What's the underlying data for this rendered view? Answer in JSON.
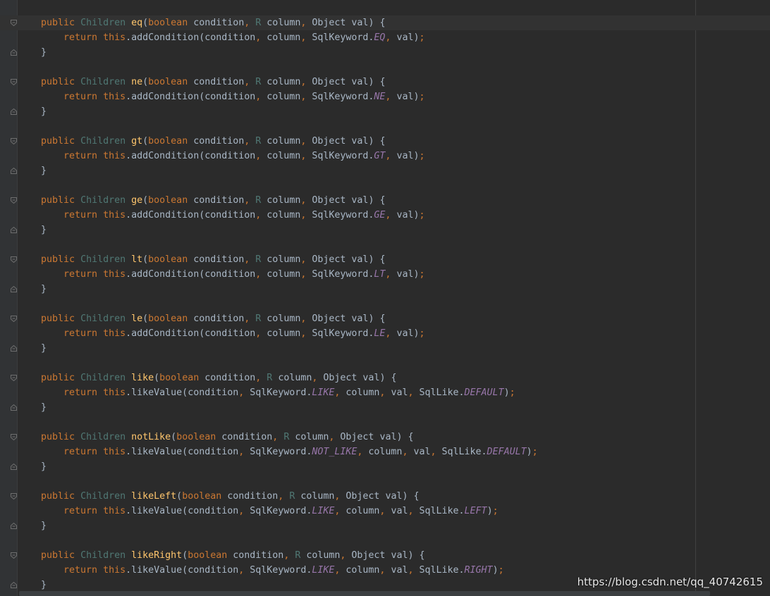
{
  "editor": {
    "language": "java",
    "colors": {
      "background": "#2b2b2b",
      "gutter": "#313335",
      "keyword": "#cc7832",
      "type_param": "#507874",
      "class_type": "#5f8fa0",
      "method": "#ffc66d",
      "constant": "#9876aa",
      "plain": "#a9b7c6",
      "current_line": "#323232"
    },
    "methods": [
      {
        "name": "eq",
        "params": [
          [
            "boolean",
            "condition"
          ],
          [
            "R",
            "column"
          ],
          [
            "Object",
            "val"
          ]
        ],
        "call": "addCondition",
        "args": [
          [
            "p",
            "condition"
          ],
          [
            "p",
            "column"
          ],
          [
            "k",
            "SqlKeyword."
          ],
          [
            "c",
            "EQ"
          ],
          [
            "p",
            "val"
          ]
        ]
      },
      {
        "name": "ne",
        "params": [
          [
            "boolean",
            "condition"
          ],
          [
            "R",
            "column"
          ],
          [
            "Object",
            "val"
          ]
        ],
        "call": "addCondition",
        "args": [
          [
            "p",
            "condition"
          ],
          [
            "p",
            "column"
          ],
          [
            "k",
            "SqlKeyword."
          ],
          [
            "c",
            "NE"
          ],
          [
            "p",
            "val"
          ]
        ]
      },
      {
        "name": "gt",
        "params": [
          [
            "boolean",
            "condition"
          ],
          [
            "R",
            "column"
          ],
          [
            "Object",
            "val"
          ]
        ],
        "call": "addCondition",
        "args": [
          [
            "p",
            "condition"
          ],
          [
            "p",
            "column"
          ],
          [
            "k",
            "SqlKeyword."
          ],
          [
            "c",
            "GT"
          ],
          [
            "p",
            "val"
          ]
        ]
      },
      {
        "name": "ge",
        "params": [
          [
            "boolean",
            "condition"
          ],
          [
            "R",
            "column"
          ],
          [
            "Object",
            "val"
          ]
        ],
        "call": "addCondition",
        "args": [
          [
            "p",
            "condition"
          ],
          [
            "p",
            "column"
          ],
          [
            "k",
            "SqlKeyword."
          ],
          [
            "c",
            "GE"
          ],
          [
            "p",
            "val"
          ]
        ]
      },
      {
        "name": "lt",
        "params": [
          [
            "boolean",
            "condition"
          ],
          [
            "R",
            "column"
          ],
          [
            "Object",
            "val"
          ]
        ],
        "call": "addCondition",
        "args": [
          [
            "p",
            "condition"
          ],
          [
            "p",
            "column"
          ],
          [
            "k",
            "SqlKeyword."
          ],
          [
            "c",
            "LT"
          ],
          [
            "p",
            "val"
          ]
        ]
      },
      {
        "name": "le",
        "params": [
          [
            "boolean",
            "condition"
          ],
          [
            "R",
            "column"
          ],
          [
            "Object",
            "val"
          ]
        ],
        "call": "addCondition",
        "args": [
          [
            "p",
            "condition"
          ],
          [
            "p",
            "column"
          ],
          [
            "k",
            "SqlKeyword."
          ],
          [
            "c",
            "LE"
          ],
          [
            "p",
            "val"
          ]
        ]
      },
      {
        "name": "like",
        "params": [
          [
            "boolean",
            "condition"
          ],
          [
            "R",
            "column"
          ],
          [
            "Object",
            "val"
          ]
        ],
        "call": "likeValue",
        "args": [
          [
            "p",
            "condition"
          ],
          [
            "k",
            "SqlKeyword."
          ],
          [
            "c",
            "LIKE"
          ],
          [
            "p",
            "column"
          ],
          [
            "p",
            "val"
          ],
          [
            "k",
            "SqlLike."
          ],
          [
            "c",
            "DEFAULT"
          ]
        ]
      },
      {
        "name": "notLike",
        "params": [
          [
            "boolean",
            "condition"
          ],
          [
            "R",
            "column"
          ],
          [
            "Object",
            "val"
          ]
        ],
        "call": "likeValue",
        "args": [
          [
            "p",
            "condition"
          ],
          [
            "k",
            "SqlKeyword."
          ],
          [
            "c",
            "NOT_LIKE"
          ],
          [
            "p",
            "column"
          ],
          [
            "p",
            "val"
          ],
          [
            "k",
            "SqlLike."
          ],
          [
            "c",
            "DEFAULT"
          ]
        ]
      },
      {
        "name": "likeLeft",
        "params": [
          [
            "boolean",
            "condition"
          ],
          [
            "R",
            "column"
          ],
          [
            "Object",
            "val"
          ]
        ],
        "call": "likeValue",
        "args": [
          [
            "p",
            "condition"
          ],
          [
            "k",
            "SqlKeyword."
          ],
          [
            "c",
            "LIKE"
          ],
          [
            "p",
            "column"
          ],
          [
            "p",
            "val"
          ],
          [
            "k",
            "SqlLike."
          ],
          [
            "c",
            "LEFT"
          ]
        ]
      },
      {
        "name": "likeRight",
        "params": [
          [
            "boolean",
            "condition"
          ],
          [
            "R",
            "column"
          ],
          [
            "Object",
            "val"
          ]
        ],
        "call": "likeValue",
        "args": [
          [
            "p",
            "condition"
          ],
          [
            "k",
            "SqlKeyword."
          ],
          [
            "c",
            "LIKE"
          ],
          [
            "p",
            "column"
          ],
          [
            "p",
            "val"
          ],
          [
            "k",
            "SqlLike."
          ],
          [
            "c",
            "RIGHT"
          ]
        ]
      }
    ],
    "tokens": {
      "public": "public",
      "return_type": "Children",
      "return": "return",
      "this": "this"
    }
  },
  "watermark": "https://blog.csdn.net/qq_40742615"
}
